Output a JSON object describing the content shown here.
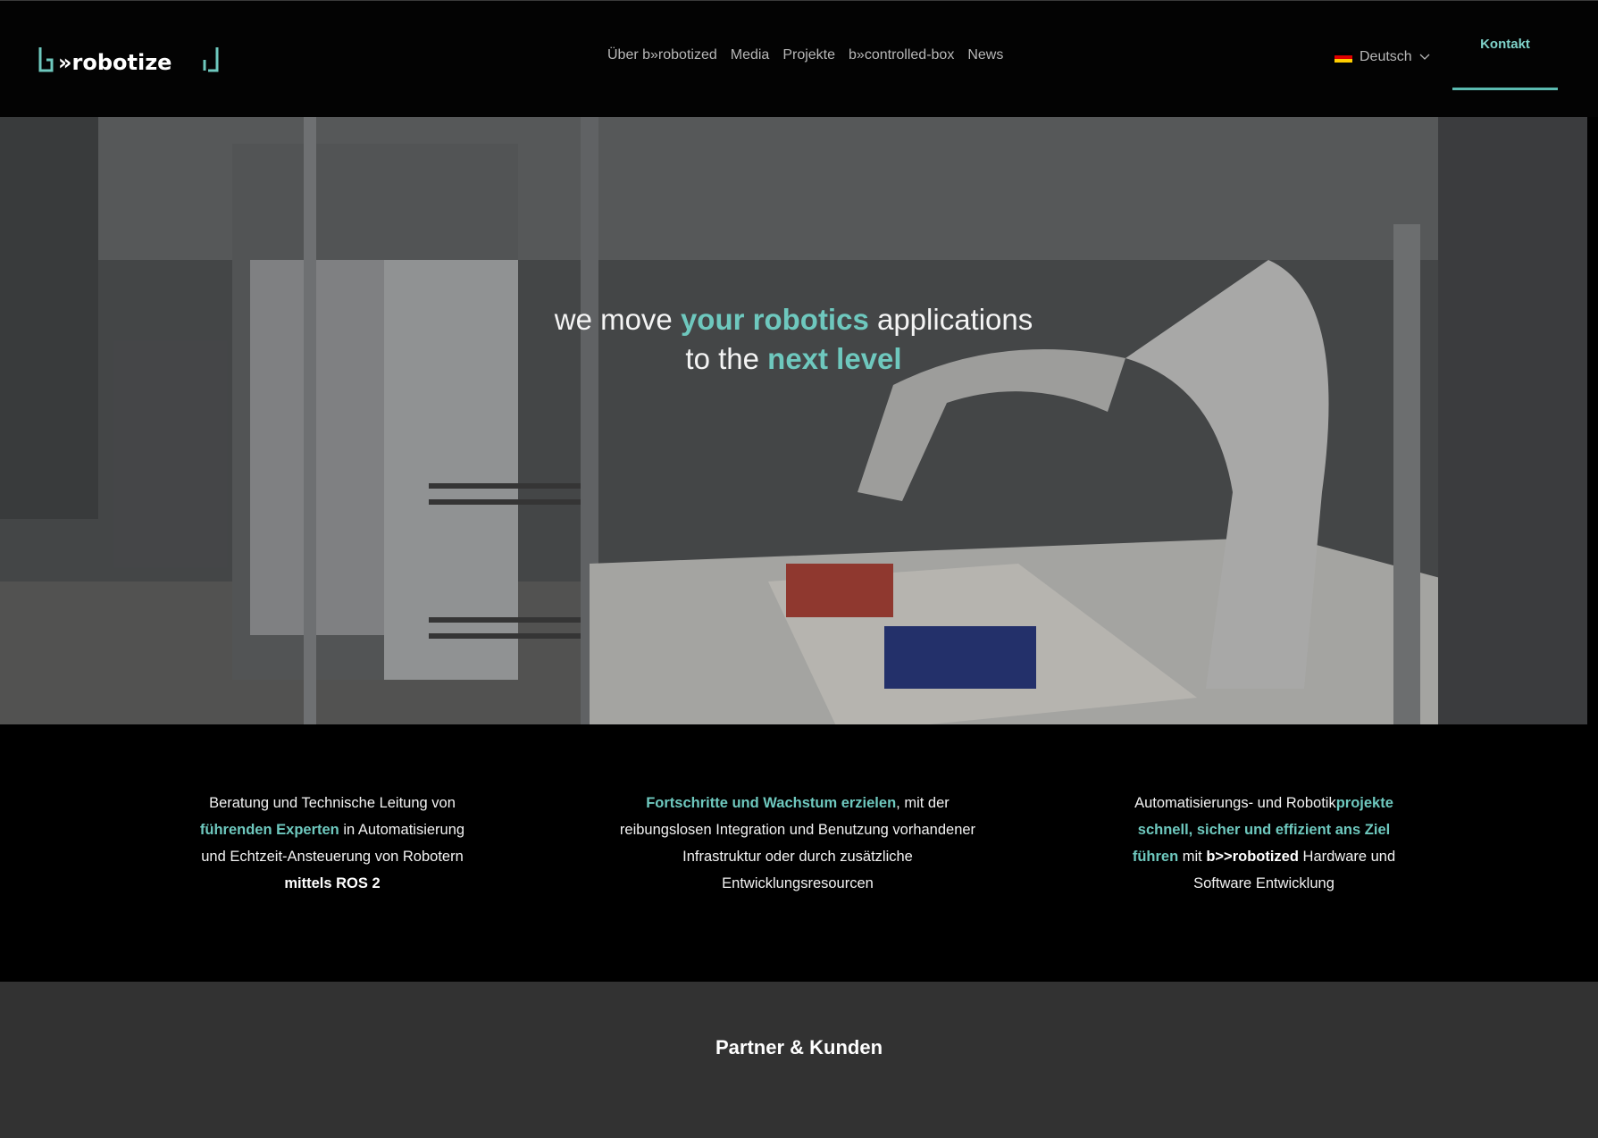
{
  "header": {
    "logo_text": "b»robotized",
    "nav": [
      "Über b»robotized",
      "Media",
      "Projekte",
      "b»controlled-box",
      "News"
    ],
    "language": "Deutsch",
    "contact": "Kontakt"
  },
  "hero": {
    "line1_pre": "we move ",
    "line1_accent": "your robotics",
    "line1_post": " applications",
    "line2_pre": "to the ",
    "line2_accent": "next level"
  },
  "features": [
    {
      "p1": "Beratung und Technische Leitung von ",
      "a1": "führenden Experten",
      "p2": " in Automatisierung und Echtzeit-Ansteuerung von Robotern ",
      "b1": "mittels ROS 2"
    },
    {
      "a1": "Fortschritte und Wachstum erzielen",
      "p1": ", mit der reibungslosen Integration und  Benutzung vorhandener Infrastruktur oder durch zusätzliche Entwicklungsresourcen"
    },
    {
      "p1": "Automatisierungs- und Robotik",
      "a1": "projekte schnell, sicher und effizient ans Ziel führen",
      "p2": " mit ",
      "b1": "b>>robotized",
      "p3": " Hardware und Software Entwicklung"
    }
  ],
  "partners": {
    "title": "Partner & Kunden"
  },
  "colors": {
    "accent": "#6ec8be",
    "background": "#000000",
    "partners_bg": "#323232"
  }
}
